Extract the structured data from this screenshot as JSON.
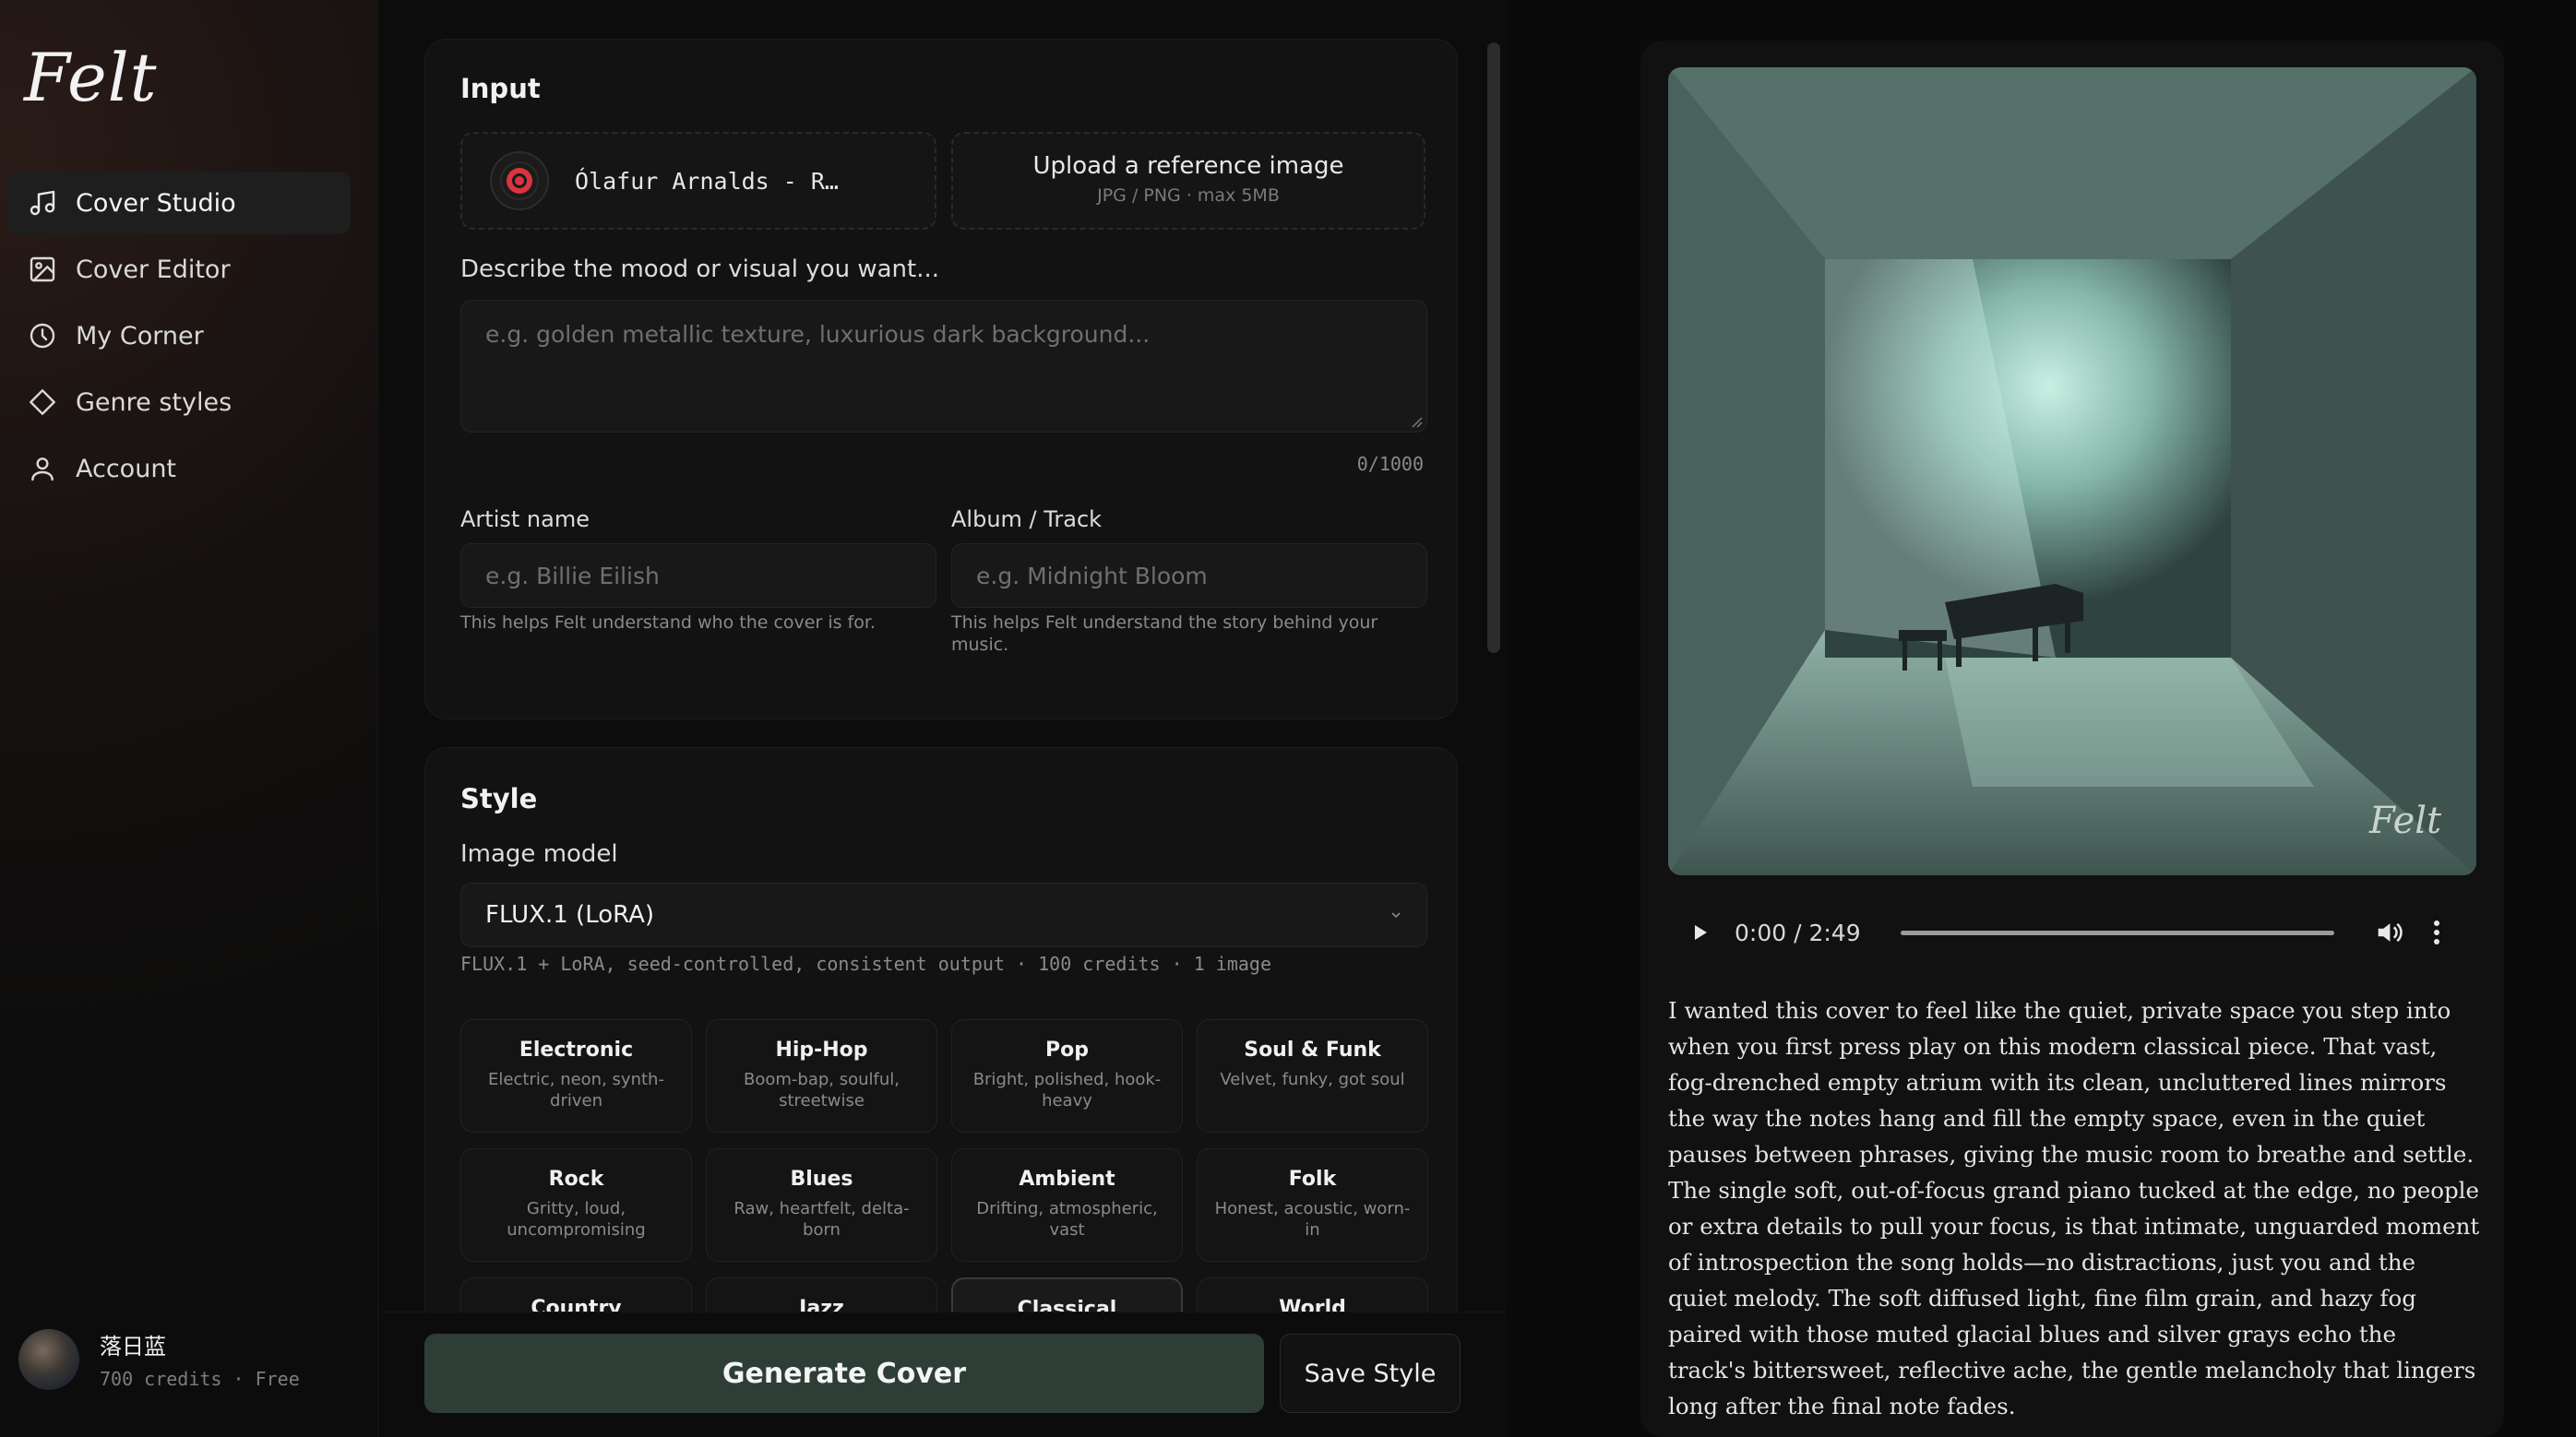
{
  "app": {
    "logo": "Felt"
  },
  "sidebar": {
    "items": [
      {
        "label": "Cover Studio",
        "icon": "music-note-icon",
        "active": true
      },
      {
        "label": "Cover Editor",
        "icon": "image-icon"
      },
      {
        "label": "My Corner",
        "icon": "clock-icon"
      },
      {
        "label": "Genre styles",
        "icon": "diamond-icon"
      },
      {
        "label": "Account",
        "icon": "user-icon"
      }
    ],
    "user": {
      "name": "落日蓝",
      "meta": "700 credits · Free"
    }
  },
  "input_panel": {
    "title": "Input",
    "track_chip": "Ólafur Arnalds - R…",
    "upload": {
      "title": "Upload a reference image",
      "subtitle": "JPG / PNG · max 5MB"
    },
    "mood_label": "Describe the mood or visual you want...",
    "mood_placeholder": "e.g. golden metallic texture, luxurious dark background...",
    "char_count": "0/1000",
    "artist": {
      "label": "Artist name",
      "placeholder": "e.g. Billie Eilish",
      "help": "This helps Felt understand who the cover is for."
    },
    "album": {
      "label": "Album / Track",
      "placeholder": "e.g. Midnight Bloom",
      "help_line1": "This helps Felt understand the story behind your",
      "help_line2": "music."
    }
  },
  "style_panel": {
    "title": "Style",
    "model_label": "Image model",
    "model_value": "FLUX.1 (LoRA)",
    "model_help": "FLUX.1 + LoRA, seed-controlled, consistent output · 100 credits · 1 image",
    "genres": [
      {
        "name": "Electronic",
        "desc_1": "Electric, neon, synth-",
        "desc_2": "driven"
      },
      {
        "name": "Hip-Hop",
        "desc_1": "Boom-bap, soulful,",
        "desc_2": "streetwise"
      },
      {
        "name": "Pop",
        "desc_1": "Bright, polished, hook-",
        "desc_2": "heavy"
      },
      {
        "name": "Soul & Funk",
        "desc_1": "Velvet, funky, got soul",
        "desc_2": ""
      },
      {
        "name": "Rock",
        "desc_1": "Gritty, loud,",
        "desc_2": "uncompromising"
      },
      {
        "name": "Blues",
        "desc_1": "Raw, heartfelt, delta-",
        "desc_2": "born"
      },
      {
        "name": "Ambient",
        "desc_1": "Drifting, atmospheric,",
        "desc_2": "vast"
      },
      {
        "name": "Folk",
        "desc_1": "Honest, acoustic, worn-",
        "desc_2": "in"
      },
      {
        "name": "Country",
        "desc_1": "",
        "desc_2": ""
      },
      {
        "name": "Jazz",
        "desc_1": "",
        "desc_2": ""
      },
      {
        "name": "Classical",
        "desc_1": "",
        "desc_2": "",
        "selected": true
      },
      {
        "name": "World",
        "desc_1": "",
        "desc_2": ""
      }
    ]
  },
  "actions": {
    "generate": "Generate Cover",
    "save": "Save Style"
  },
  "preview": {
    "watermark": "Felt",
    "player": {
      "time": "0:00 / 2:49",
      "progress": 0
    },
    "description": "I wanted this cover to feel like the quiet, private space you step into when you first press play on this modern classical piece. That vast, fog-drenched empty atrium with its clean, uncluttered lines mirrors the way the notes hang and fill the empty space, even in the quiet pauses between phrases, giving the music room to breathe and settle. The single soft, out-of-focus grand piano tucked at the edge, no people or extra details to pull your focus, is that intimate, unguarded moment of introspection the song holds—no distractions, just you and the quiet melody. The soft diffused light, fine film grain, and hazy fog paired with those muted glacial blues and silver grays echo the track's bittersweet, reflective ache, the gentle melancholy that lingers long after the final note fades."
  },
  "colors": {
    "accent_green": "#2e3d35",
    "record_red": "#d9343f"
  }
}
